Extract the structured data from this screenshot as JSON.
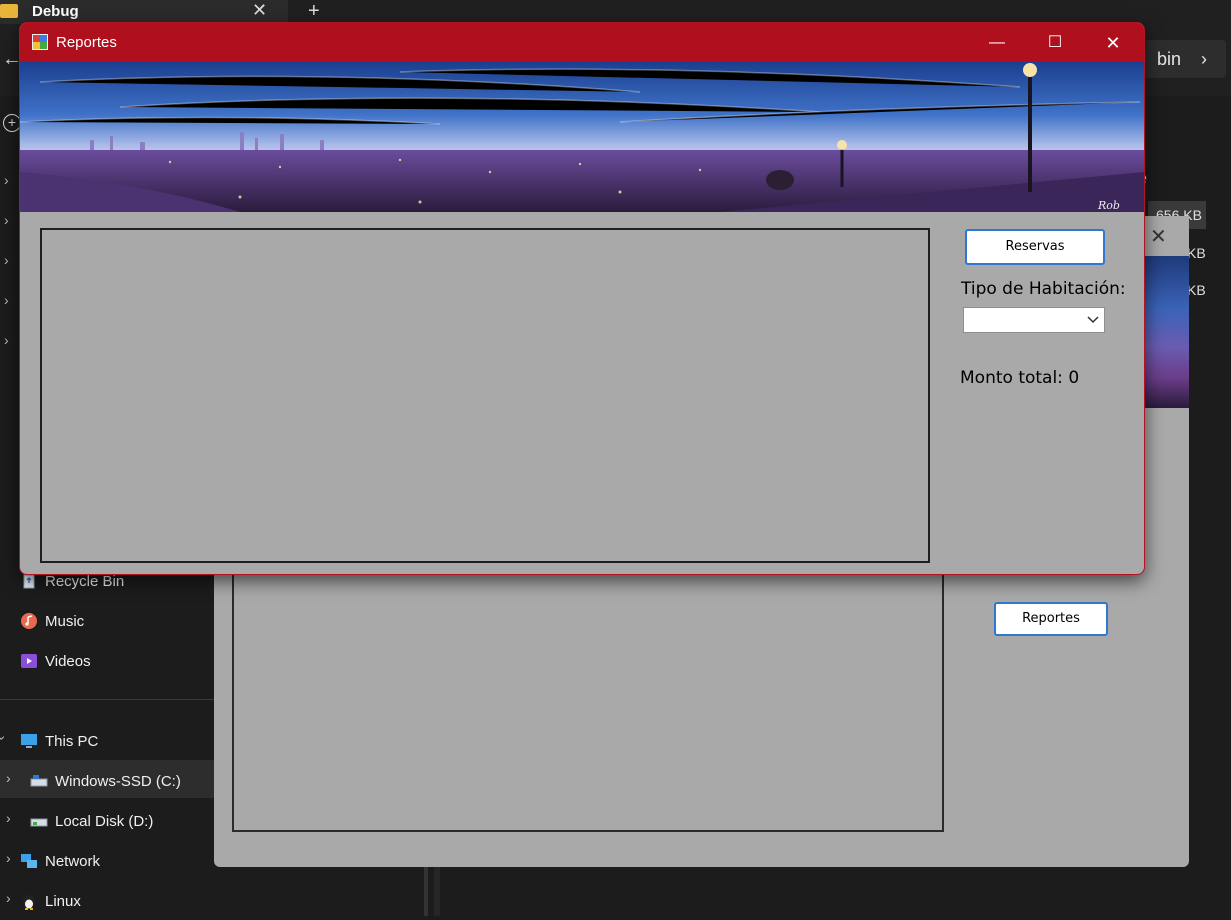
{
  "explorer": {
    "tab_title": "Debug",
    "tab_close": "✕",
    "tab_new": "+",
    "breadcrumb_last": "bin",
    "nav_items": {
      "recycle_bin": "Recycle Bin",
      "music": "Music",
      "videos": "Videos",
      "this_pc": "This PC",
      "windows_ssd": "Windows-SSD (C:)",
      "local_disk": "Local Disk (D:)",
      "network": "Network",
      "linux": "Linux"
    },
    "sizes": [
      "656 KB",
      "KB",
      "KB"
    ],
    "column_header_fragment": "e"
  },
  "background_form": {
    "button_label": "Reportes",
    "close_glyph": "✕"
  },
  "reportes_window": {
    "title": "Reportes",
    "minimize_glyph": "—",
    "maximize_glyph": "☐",
    "close_glyph": "✕",
    "reservas_button": "Reservas",
    "tipo_label": "Tipo de Habitación:",
    "tipo_selected": "",
    "monto_label": "Monto total: 0",
    "banner_signature": "Rob"
  },
  "colors": {
    "titlebar": "#b00f1d",
    "form_bg": "#a9a9a9",
    "button_border": "#2f78d1",
    "explorer_bg": "#1c1c1c"
  }
}
